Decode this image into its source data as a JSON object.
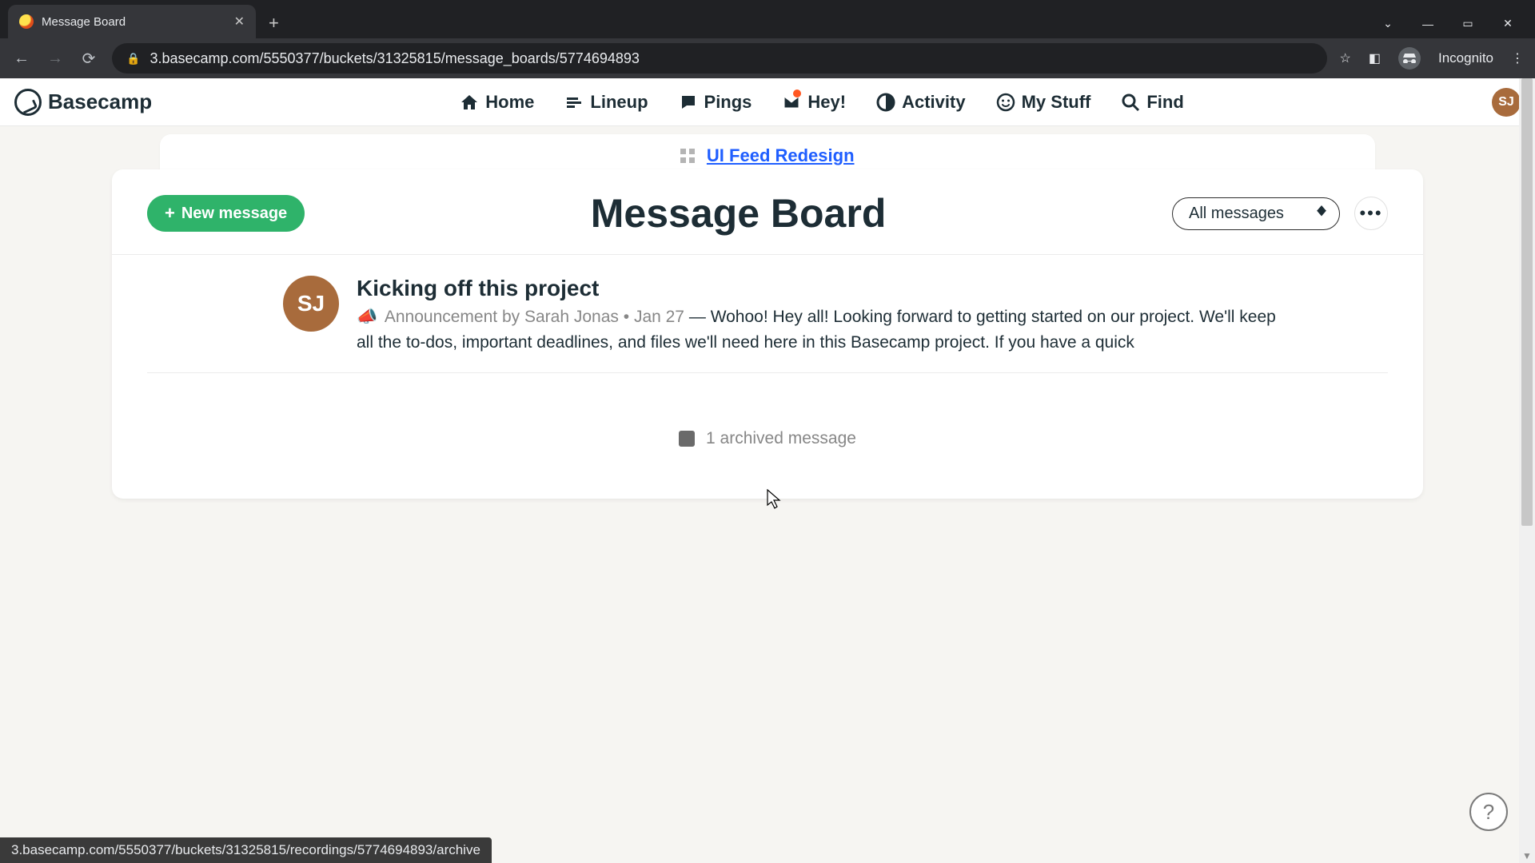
{
  "browser": {
    "tab_title": "Message Board",
    "url_display": "3.basecamp.com/5550377/buckets/31325815/message_boards/5774694893",
    "incognito_label": "Incognito"
  },
  "nav": {
    "logo": "Basecamp",
    "items": {
      "home": "Home",
      "lineup": "Lineup",
      "pings": "Pings",
      "hey": "Hey!",
      "activity": "Activity",
      "mystuff": "My Stuff",
      "find": "Find"
    },
    "avatar_initials": "SJ"
  },
  "breadcrumb": {
    "project": "UI Feed Redesign"
  },
  "board": {
    "new_button": "New message",
    "title": "Message Board",
    "filter_selected": "All messages"
  },
  "messages": [
    {
      "avatar_initials": "SJ",
      "title": "Kicking off this project",
      "category": "Announcement",
      "author": "Sarah Jonas",
      "date": "Jan 27",
      "preview": "Wohoo! Hey all! Looking forward to getting started on our project. We'll keep all the to-dos, important deadlines, and files we'll need here in this Basecamp project. If you have a quick"
    }
  ],
  "archived": {
    "label": "1 archived message"
  },
  "status_bar": "3.basecamp.com/5550377/buckets/31325815/recordings/5774694893/archive",
  "help": "?"
}
